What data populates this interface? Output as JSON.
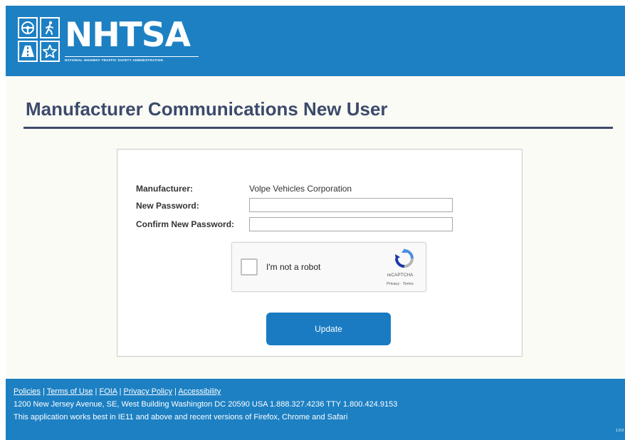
{
  "header": {
    "logo_text": "NHTSA",
    "logo_subtitle": "NATIONAL HIGHWAY TRAFFIC SAFETY ADMINISTRATION"
  },
  "page": {
    "title": "Manufacturer Communications New User"
  },
  "form": {
    "manufacturer_label": "Manufacturer:",
    "manufacturer_value": "Volpe Vehicles Corporation",
    "new_password_label": "New Password:",
    "new_password_value": "",
    "confirm_password_label": "Confirm New Password:",
    "confirm_password_value": "",
    "captcha": {
      "checkbox_label": "I'm not a robot",
      "brand": "reCAPTCHA",
      "links": "Privacy - Terms"
    },
    "update_label": "Update"
  },
  "footer": {
    "links": [
      "Policies",
      "Terms of Use",
      "FOIA",
      "Privacy Policy",
      "Accessibility"
    ],
    "address": "1200 New Jersey Avenue, SE, West Building Washington DC 20590 USA 1.888.327.4236 TTY 1.800.424.9153",
    "browser_note": "This application works best in IE11 and above and recent versions of Firefox, Chrome and Safari",
    "version": "1.0.0"
  },
  "colors": {
    "brand_blue": "#1d80c3",
    "title_navy": "#3c4a6b",
    "button_blue": "#1a7bc2"
  },
  "icons": [
    "steering-wheel-icon",
    "pedestrian-icon",
    "road-icon",
    "star-icon",
    "recaptcha-icon"
  ]
}
